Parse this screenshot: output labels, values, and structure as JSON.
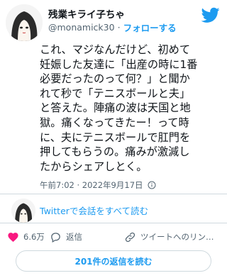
{
  "author": {
    "display_name": "残業キライ子ちゃ",
    "handle": "@monamick30",
    "separator": "·",
    "follow_label": "フォローする"
  },
  "tweet": {
    "lines": [
      "これ、マジなんだけど、初めて",
      "妊娠した友達に「出産の時に1番",
      "必要だったのって何？」と聞か",
      "れて秒で「テニスボールと夫」",
      "と答えた。陣痛の波は天国と地",
      "獄。痛くなってきたー！って時",
      "に、夫にテニスボールで肛門を",
      "押してもらうの。痛みが激減し",
      "たからシェアしとく。"
    ],
    "timestamp": "午前7:02 · 2022年9月17日"
  },
  "conversation": {
    "link_label": "Twitterで会話をすべて読む"
  },
  "actions": {
    "like_count": "6.6万",
    "reply_label": "返信",
    "share_label": "ツイートへのリン…"
  },
  "replies_button": {
    "label": "201件の返信を読む"
  },
  "colors": {
    "accent": "#1d9bf0",
    "like": "#f91880",
    "muted": "#536471"
  },
  "icons": [
    "twitter-bird-icon",
    "info-icon",
    "heart-icon",
    "reply-icon",
    "link-icon"
  ]
}
